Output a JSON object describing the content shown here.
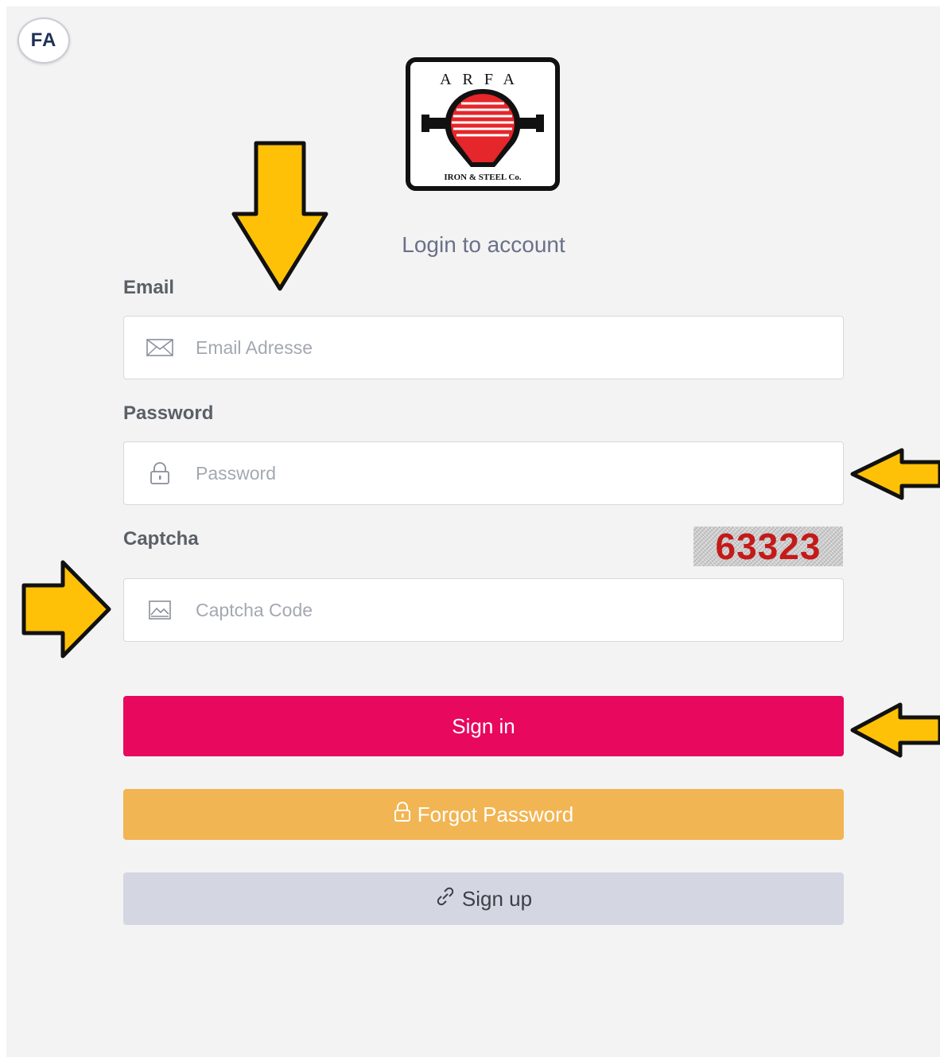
{
  "avatar": {
    "initials": "FA"
  },
  "logo": {
    "arc_text": "ARFA",
    "company": "IRON & STEEL Co."
  },
  "login": {
    "title": "Login to account",
    "email_label": "Email",
    "email_placeholder": "Email Adresse",
    "password_label": "Password",
    "password_placeholder": "Password",
    "captcha_label": "Captcha",
    "captcha_value": "63323",
    "captcha_placeholder": "Captcha Code",
    "signin_label": "Sign in",
    "forgot_label": "Forgot Password",
    "signup_label": "Sign up"
  },
  "colors": {
    "signin": "#e8085e",
    "forgot": "#f2b553",
    "signup": "#d4d7e1",
    "annotation_arrow": "#ffc107"
  },
  "icons": [
    "mail-icon",
    "lock-icon",
    "image-icon",
    "link-icon"
  ]
}
